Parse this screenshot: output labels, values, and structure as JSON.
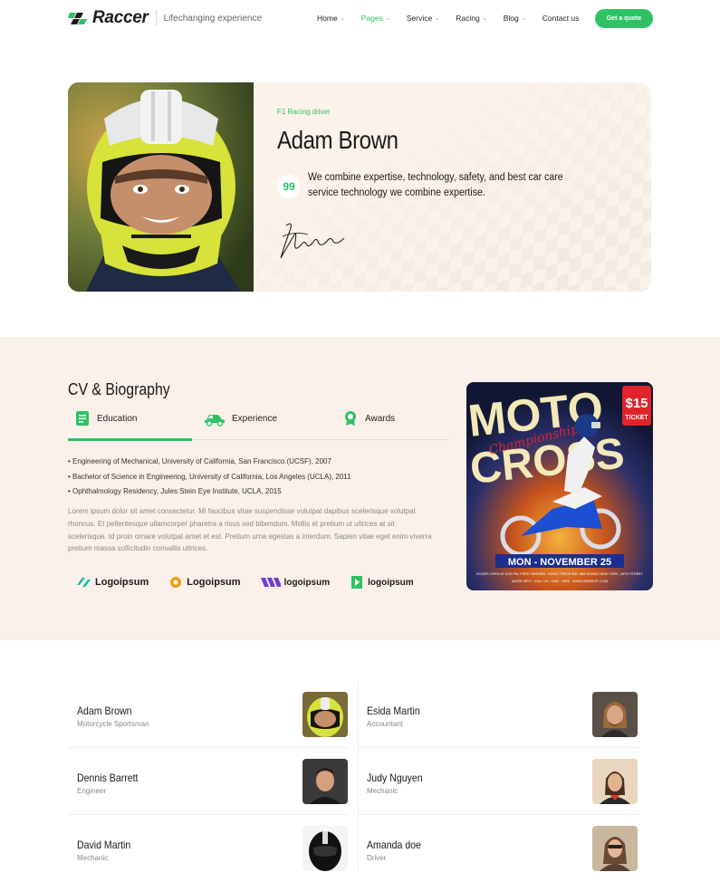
{
  "header": {
    "brand": "Raccer",
    "tagline": "Lifechanging experience",
    "nav": [
      {
        "label": "Home",
        "dropdown": true,
        "active": false
      },
      {
        "label": "Pages",
        "dropdown": true,
        "active": true
      },
      {
        "label": "Service",
        "dropdown": true,
        "active": false
      },
      {
        "label": "Racing",
        "dropdown": true,
        "active": false
      },
      {
        "label": "Blog",
        "dropdown": true,
        "active": false
      },
      {
        "label": "Contact us",
        "dropdown": false,
        "active": false
      }
    ],
    "cta": "Get a quote"
  },
  "hero": {
    "eyebrow": "F1 Racing driver",
    "name": "Adam Brown",
    "quote_mark": "99",
    "quote": "We combine expertise, technology, safety, and best car care service technology we combine expertise."
  },
  "cv": {
    "title": "CV & Biography",
    "tabs": [
      {
        "label": "Education",
        "icon": "book-icon",
        "active": true
      },
      {
        "label": "Experience",
        "icon": "car-icon",
        "active": false
      },
      {
        "label": "Awards",
        "icon": "award-icon",
        "active": false
      }
    ],
    "education": [
      "Engineering of Mechanical, University of California, San Francisco (UCSF), 2007",
      "Bachelor of Science in Engineering, University of California, Los Angeles (UCLA), 2011",
      "Ophthalmology Residency, Jules Stein Eye Institute, UCLA, 2015"
    ],
    "paragraph": "Lorem ipsum dolor sit amet consectetur. Mi faucibus vitae suspendisse volutpat dapibus scelerisque volutpat rhoncus. Et pellentesque ullamcorper pharetra a risus sed bibendum. Mollis et pretium ut ultrices at sit scelerisque. Id proin ornare volutpat amet et est. Pretium urna egestas a interdum. Sapien vitae eget enim viverra pretium massa sollicitudin convallis ultrices.",
    "partner_logos": [
      "Logoipsum",
      "Logoipsum",
      "logoipsum",
      "logoipsum"
    ]
  },
  "poster": {
    "title_top": "MOTO",
    "title_bottom": "CROSS",
    "script": "Championship",
    "price": "$15",
    "ticket": "TICKET",
    "date": "MON - NOVEMBER 25",
    "info1": "DOORS OPEN AT 8:00 PM, FREE PARKING, TICKET PRICE $30, 865 GRAND NEW YORK, 26TH STREET",
    "info2": "MORE INFO : CALL US : 0000 - 9999 - WWW.WEBSITE.COM"
  },
  "team": [
    {
      "name": "Adam Brown",
      "role": "Motorcycle Sportsman"
    },
    {
      "name": "Esida Martin",
      "role": "Accountant"
    },
    {
      "name": "Dennis Barrett",
      "role": "Engineer"
    },
    {
      "name": "Judy Nguyen",
      "role": "Mechanic"
    },
    {
      "name": "David Martin",
      "role": "Mechanic"
    },
    {
      "name": "Amanda doe",
      "role": "Driver"
    }
  ],
  "colors": {
    "accent": "#2ec265",
    "section_bg": "#fbf1ea",
    "text": "#1a1a1a"
  }
}
